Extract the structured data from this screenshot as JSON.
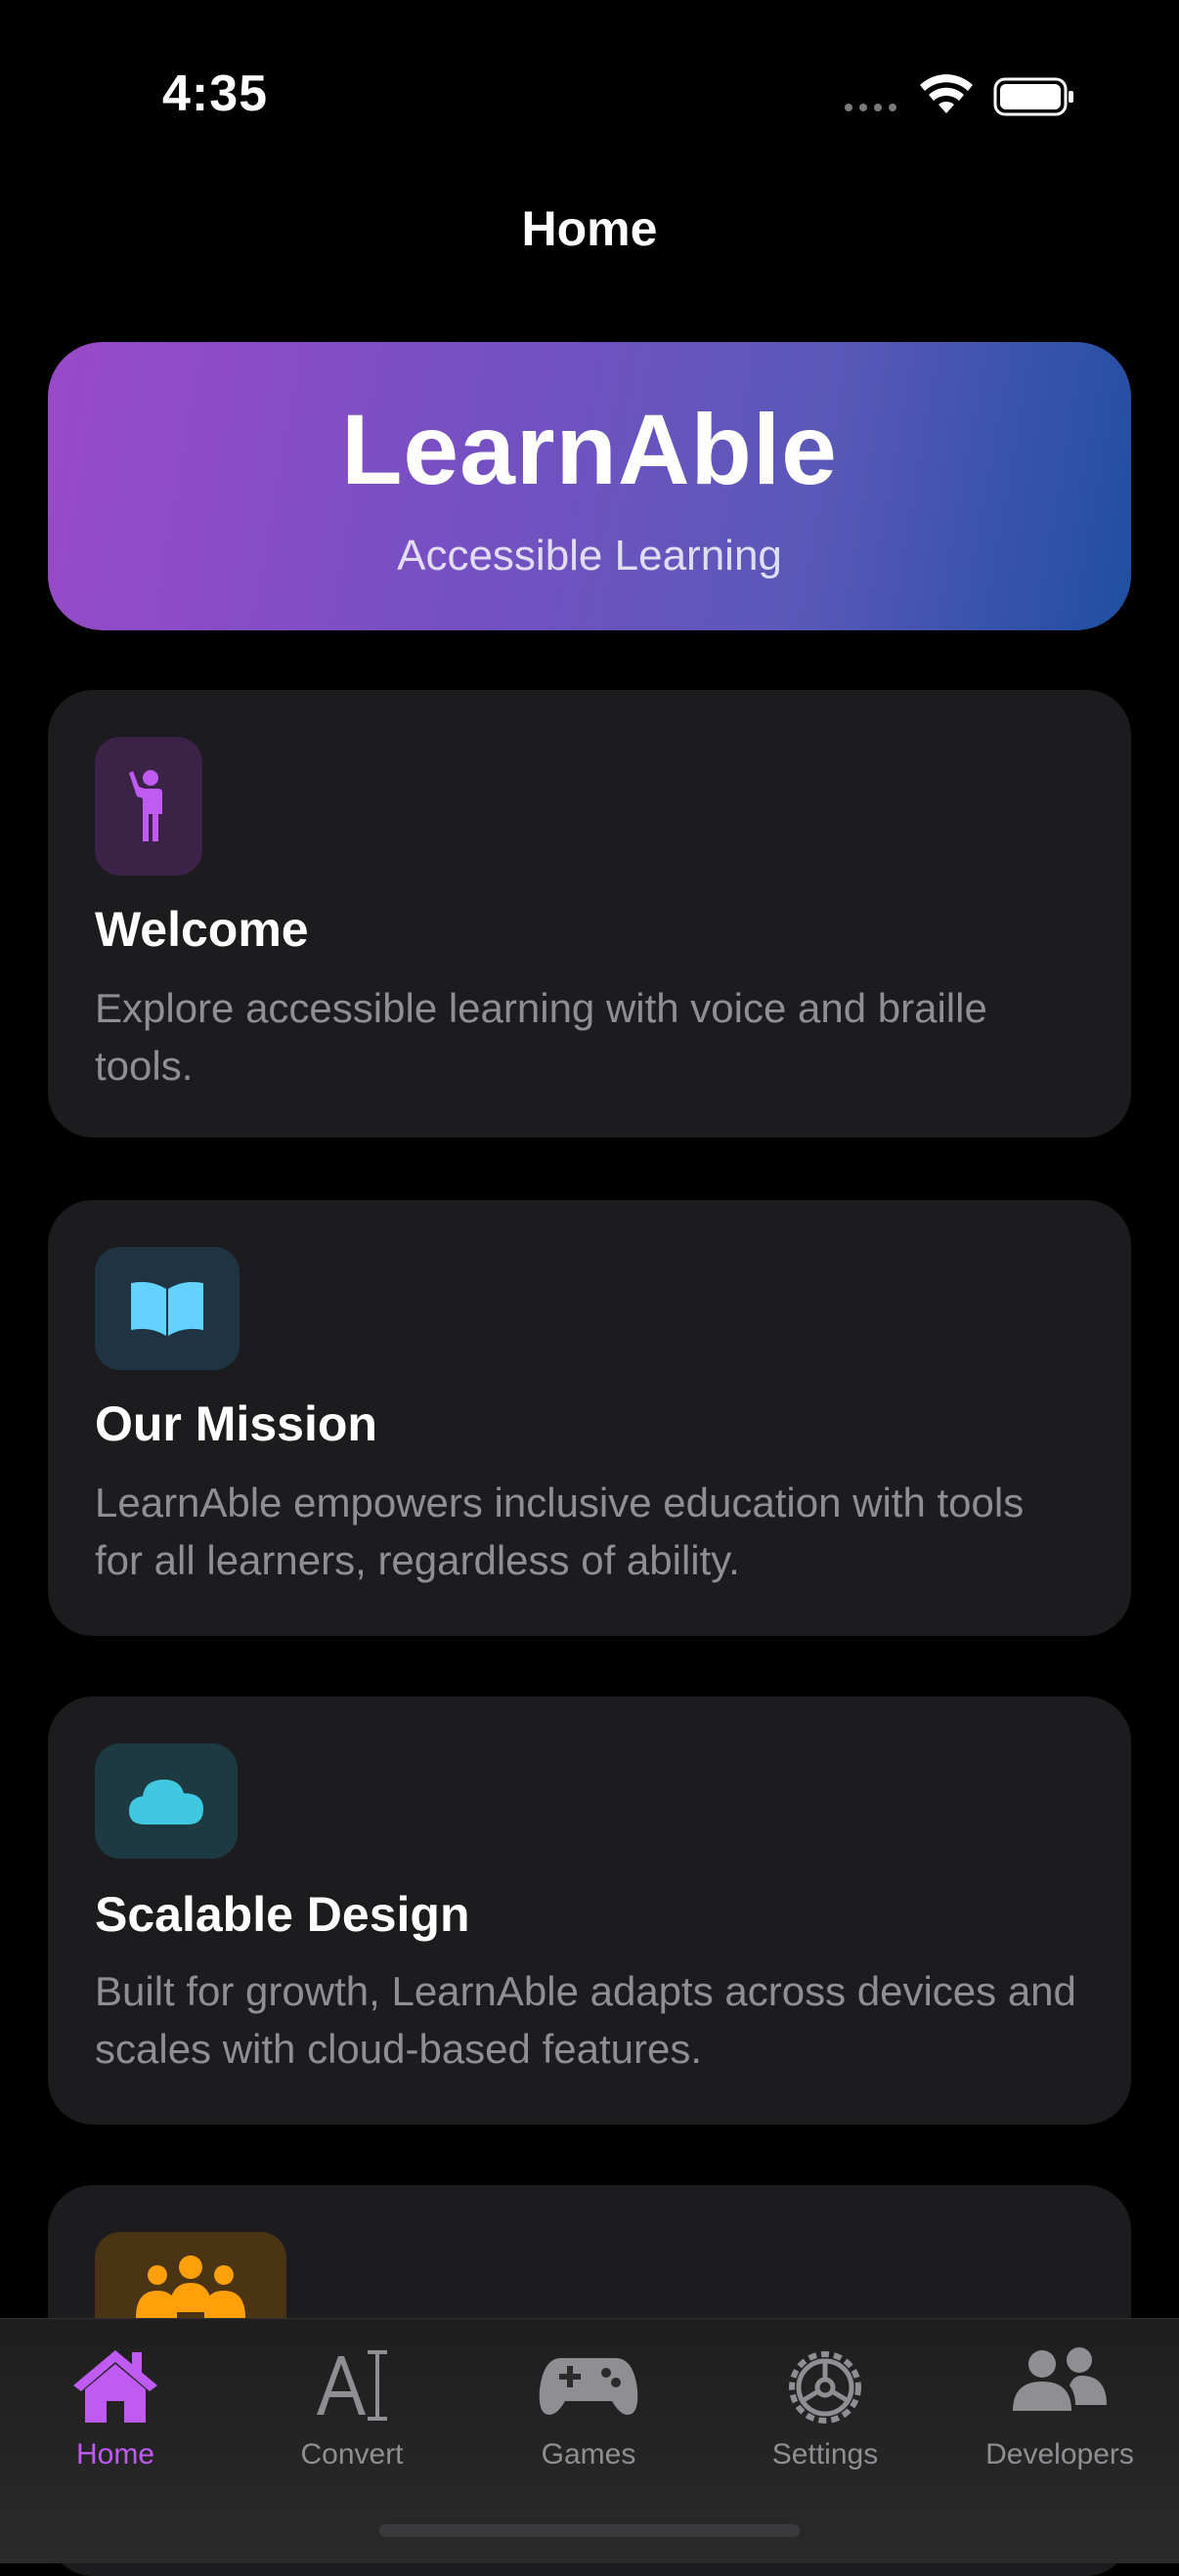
{
  "status_bar": {
    "time": "4:35"
  },
  "nav": {
    "title": "Home"
  },
  "hero": {
    "title": "LearnAble",
    "subtitle": "Accessible Learning",
    "gradient_start": "#9a4ac8",
    "gradient_end": "#1f4fa0"
  },
  "cards": [
    {
      "icon": "person-waving-icon",
      "icon_color": "#bf5af2",
      "title": "Welcome",
      "description": "Explore accessible learning with voice and braille tools."
    },
    {
      "icon": "open-book-icon",
      "icon_color": "#64d2ff",
      "title": "Our Mission",
      "description": "LearnAble empowers inclusive education with tools for all learners, regardless of ability."
    },
    {
      "icon": "cloud-icon",
      "icon_color": "#40c8e0",
      "title": "Scalable Design",
      "description": "Built for growth, LearnAble adapts across devices and scales with cloud-based features."
    },
    {
      "icon": "people-group-icon",
      "icon_color": "#ff9f0a",
      "title": "",
      "description": ""
    }
  ],
  "tab_bar": {
    "items": [
      {
        "label": "Home",
        "icon": "house-icon",
        "active": true
      },
      {
        "label": "Convert",
        "icon": "text-cursor-icon",
        "active": false
      },
      {
        "label": "Games",
        "icon": "gamecontroller-icon",
        "active": false
      },
      {
        "label": "Settings",
        "icon": "gear-icon",
        "active": false
      },
      {
        "label": "Developers",
        "icon": "people-icon",
        "active": false
      }
    ],
    "active_color": "#bf5af2",
    "inactive_color": "#8e8e93"
  }
}
